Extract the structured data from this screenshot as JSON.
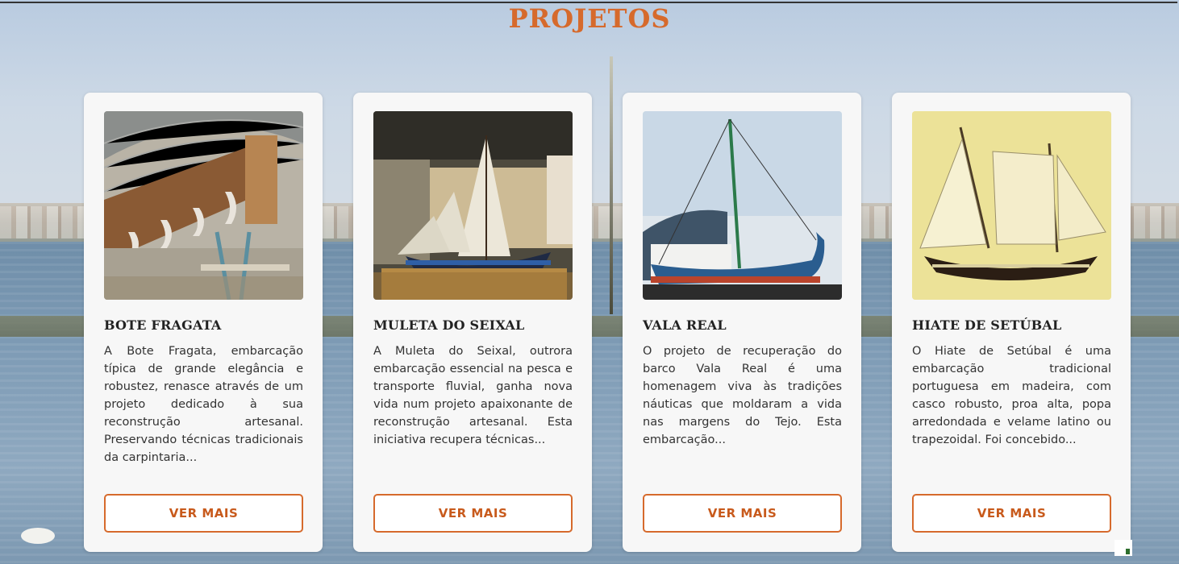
{
  "page": {
    "title": "PROJETOS",
    "accent_color": "#d66a2c"
  },
  "cards": [
    {
      "title": "BOTE FRAGATA",
      "text": "A Bote Fragata, embarcação típica de grande elegância e robustez, renasce através de um projeto dedicado à sua reconstrução artesanal. Preservando técnicas tradicionais da carpintaria...",
      "button": "VER MAIS",
      "image": "boat-under-construction-photo"
    },
    {
      "title": "MULETA DO SEIXAL",
      "text": "A Muleta do Seixal, outrora embarcação essencial na pesca e transporte fluvial, ganha nova vida num projeto apaixonante de reconstrução artesanal. Esta iniciativa recupera técnicas...",
      "button": "VER MAIS",
      "image": "model-sailboat-photo"
    },
    {
      "title": "VALA REAL",
      "text": "O projeto de recuperação do barco Vala Real é uma homenagem viva às tradições náuticas que moldaram a vida nas margens do Tejo. Esta embarcação...",
      "button": "VER MAIS",
      "image": "boat-on-land-photo"
    },
    {
      "title": "HIATE DE SETÚBAL",
      "text": "O Hiate de Setúbal é uma embarcação tradicional portuguesa em madeira, com casco robusto, proa alta, popa arredondada e velame latino ou trapezoidal. Foi concebido...",
      "button": "VER MAIS",
      "image": "sailboat-painting"
    }
  ]
}
